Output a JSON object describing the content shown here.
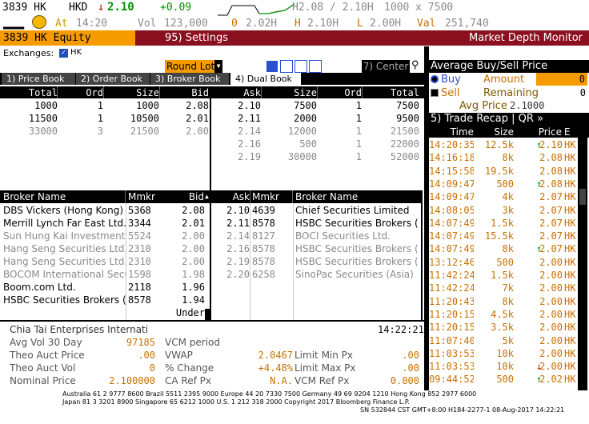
{
  "quote": {
    "ticker": "3839 HK",
    "ccy": "HKD",
    "last": "2.10",
    "change": "+0.09",
    "hilo": "H2.08 / 2.10H",
    "size": "1000 x 7500",
    "at_label": "At",
    "time": "14:20",
    "vol_label": "Vol",
    "vol": "123,000",
    "o_label": "0",
    "open": "2.02H",
    "h_label": "H",
    "high": "2.10H",
    "l_label": "L",
    "low": "2.00H",
    "val_label": "Val",
    "value": "251,740"
  },
  "bar": {
    "security": "3839 HK Equity",
    "settings": "95) Settings",
    "title": "Market Depth Monitor"
  },
  "exchanges": {
    "label": "Exchanges:",
    "value": "HK"
  },
  "controls": {
    "round_lot": "Round Lot",
    "center": "7) Center"
  },
  "tabs": [
    {
      "label": "1) Price Book"
    },
    {
      "label": "2) Order Book"
    },
    {
      "label": "3) Broker Book"
    },
    {
      "label": "4) Dual Book"
    }
  ],
  "book": {
    "headers": {
      "total": "Total",
      "ord": "Ord",
      "size": "Size",
      "bid": "Bid",
      "ask": "Ask",
      "asize": "Size",
      "aord": "Ord",
      "atotal": "Total"
    },
    "bids": [
      {
        "total": "1000",
        "ord": "1",
        "size": "1000",
        "bid": "2.08",
        "gray": false
      },
      {
        "total": "11500",
        "ord": "1",
        "size": "10500",
        "bid": "2.01",
        "gray": false
      },
      {
        "total": "33000",
        "ord": "3",
        "size": "21500",
        "bid": "2.00",
        "gray": true
      }
    ],
    "asks": [
      {
        "ask": "2.10",
        "size": "7500",
        "ord": "1",
        "total": "7500",
        "gray": false
      },
      {
        "ask": "2.11",
        "size": "2000",
        "ord": "1",
        "total": "9500",
        "gray": false
      },
      {
        "ask": "2.14",
        "size": "12000",
        "ord": "1",
        "total": "21500",
        "gray": true
      },
      {
        "ask": "2.16",
        "size": "500",
        "ord": "1",
        "total": "22000",
        "gray": true
      },
      {
        "ask": "2.19",
        "size": "30000",
        "ord": "1",
        "total": "52000",
        "gray": true
      }
    ]
  },
  "brokers": {
    "headers": {
      "name": "Broker Name",
      "mmkr": "Mmkr",
      "bid": "Bid",
      "ask": "Ask",
      "amkr": "Mmkr",
      "aname": "Broker Name"
    },
    "bids": [
      {
        "name": "DBS Vickers (Hong Kong)",
        "mmkr": "5368",
        "bid": "2.08",
        "gray": false
      },
      {
        "name": "Merrill Lynch Far East Ltd.",
        "mmkr": "3344",
        "bid": "2.01",
        "gray": false
      },
      {
        "name": "Sun Hung Kai Investment",
        "mmkr": "5524",
        "bid": "2.00",
        "gray": true
      },
      {
        "name": "Hang Seng Securities Ltd.",
        "mmkr": "2310",
        "bid": "2.00",
        "gray": true
      },
      {
        "name": "Hang Seng Securities Ltd.",
        "mmkr": "2310",
        "bid": "2.00",
        "gray": true
      },
      {
        "name": "BOCOM International Secu",
        "mmkr": "1598",
        "bid": "1.98",
        "gray": true
      },
      {
        "name": "Boom.com Ltd.",
        "mmkr": "2118",
        "bid": "1.96",
        "gray": false
      },
      {
        "name": "HSBC Securities Brokers (",
        "mmkr": "8578",
        "bid": "1.94",
        "gray": false
      },
      {
        "name": "",
        "mmkr": "",
        "bid": "Under",
        "gray": false
      }
    ],
    "asks": [
      {
        "ask": "2.10",
        "mmkr": "4639",
        "name": "Chief Securities Limited",
        "gray": false
      },
      {
        "ask": "2.11",
        "mmkr": "8578",
        "name": "HSBC Securities Brokers (",
        "gray": false
      },
      {
        "ask": "2.14",
        "mmkr": "8127",
        "name": "BOCI Securities Ltd.",
        "gray": true
      },
      {
        "ask": "2.16",
        "mmkr": "8578",
        "name": "HSBC Securities Brokers (",
        "gray": true
      },
      {
        "ask": "2.19",
        "mmkr": "8578",
        "name": "HSBC Securities Brokers (",
        "gray": true
      },
      {
        "ask": "2.20",
        "mmkr": "6258",
        "name": "SinoPac Securities (Asia)",
        "gray": true
      }
    ]
  },
  "info": {
    "company": "Chia Tai Enterprises Internati",
    "time": "14:22:21",
    "rows": [
      {
        "l1": "Avg Vol 30 Day",
        "v1": "97185",
        "l2": "VCM period",
        "v2": "",
        "l3": "",
        "v3": ""
      },
      {
        "l1": "Theo Auct Price",
        "v1": ".00",
        "l2": "VWAP",
        "v2": "2.0467",
        "l3": "Limit Min Px",
        "v3": ".00"
      },
      {
        "l1": "Theo Auct Vol",
        "v1": "0",
        "l2": "% Change",
        "v2": "+4.48%",
        "l3": "Limit Max Px",
        "v3": ".00"
      },
      {
        "l1": "Nominal Price",
        "v1": "2.100000",
        "l2": "CA Ref Px",
        "v2": "N.A.",
        "l3": "VCM Ref Px",
        "v3": "0.000"
      }
    ]
  },
  "avg": {
    "title": "Average Buy/Sell Price",
    "buy": "Buy",
    "amount_label": "Amount",
    "amount": "0",
    "sell": "Sell",
    "remaining_label": "Remaining",
    "remaining": "0",
    "avg_price_label": "Avg Price",
    "avg_price": "2.1000"
  },
  "recap": {
    "title": "5) Trade Recap",
    "qr": "QR »",
    "headers": {
      "time": "Time",
      "size": "Size",
      "price": "Price",
      "e": "E"
    },
    "rows": [
      {
        "time": "14:20:35",
        "size": "12.5k",
        "price": "2.10",
        "dir": "up",
        "e": "HK"
      },
      {
        "time": "14:16:18",
        "size": "8k",
        "price": "2.08",
        "dir": "",
        "e": "HK"
      },
      {
        "time": "14:15:58",
        "size": "19.5k",
        "price": "2.08",
        "dir": "",
        "e": "HK"
      },
      {
        "time": "14:09:47",
        "size": "500",
        "price": "2.08",
        "dir": "up",
        "e": "HK"
      },
      {
        "time": "14:09:47",
        "size": "4k",
        "price": "2.07",
        "dir": "",
        "e": "HK"
      },
      {
        "time": "14:08:05",
        "size": "3k",
        "price": "2.07",
        "dir": "",
        "e": "HK"
      },
      {
        "time": "14:07:49",
        "size": "1.5k",
        "price": "2.07",
        "dir": "",
        "e": "HK"
      },
      {
        "time": "14:07:49",
        "size": "15.5k",
        "price": "2.07",
        "dir": "",
        "e": "HK"
      },
      {
        "time": "14:07:49",
        "size": "8k",
        "price": "2.07",
        "dir": "up",
        "e": "HK"
      },
      {
        "time": "13:12:46",
        "size": "500",
        "price": "2.00",
        "dir": "",
        "e": "HK"
      },
      {
        "time": "11:42:24",
        "size": "1.5k",
        "price": "2.00",
        "dir": "",
        "e": "HK"
      },
      {
        "time": "11:42:24",
        "size": "7k",
        "price": "2.00",
        "dir": "",
        "e": "HK"
      },
      {
        "time": "11:20:43",
        "size": "8k",
        "price": "2.00",
        "dir": "",
        "e": "HK"
      },
      {
        "time": "11:20:15",
        "size": "4.5k",
        "price": "2.00",
        "dir": "",
        "e": "HK"
      },
      {
        "time": "11:20:15",
        "size": "3.5k",
        "price": "2.00",
        "dir": "",
        "e": "HK"
      },
      {
        "time": "11:07:40",
        "size": "5k",
        "price": "2.00",
        "dir": "",
        "e": "HK"
      },
      {
        "time": "11:03:53",
        "size": "10k",
        "price": "2.00",
        "dir": "",
        "e": "HK"
      },
      {
        "time": "11:03:53",
        "size": "10k",
        "price": "2.00",
        "dir": "down",
        "e": "HK"
      },
      {
        "time": "09:44:52",
        "size": "500",
        "price": "2.02",
        "dir": "up",
        "e": "HK"
      }
    ]
  },
  "footer": {
    "line1": "Australia 61 2 9777 8600 Brazil 5511 2395 9000 Europe 44 20 7330 7500 Germany 49 69 9204 1210 Hong Kong 852 2977 6000",
    "line2": "Japan 81 3 3201 8900          Singapore 65 6212 1000          U.S. 1 212 318 2000          Copyright 2017 Bloomberg Finance L.P.",
    "line3": "SN 532844 CST  GMT+8:00 H184-2277-1 08-Aug-2017 14:22:21"
  }
}
